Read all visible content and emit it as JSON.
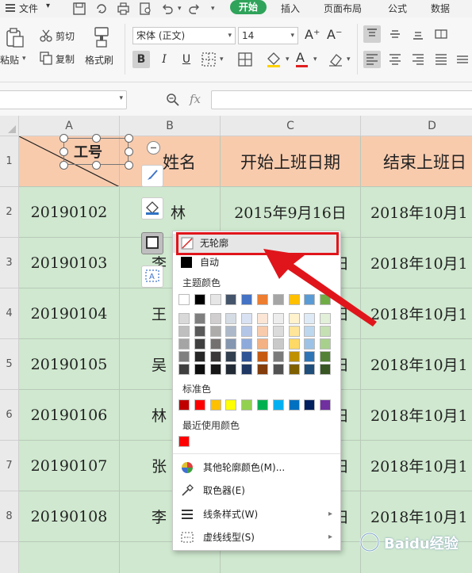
{
  "menubar": {
    "file_label": "文件",
    "tabs": [
      "开始",
      "插入",
      "页面布局",
      "公式",
      "数据"
    ]
  },
  "ribbon": {
    "paste_label": "粘贴",
    "cut_label": "剪切",
    "copy_label": "复制",
    "format_painter_label": "格式刷",
    "font_name": "宋体 (正文)",
    "font_size": "14",
    "bold": "B",
    "italic": "I",
    "underline": "U",
    "increase_font": "A⁺",
    "decrease_font": "A⁻",
    "font_color_accent": "#e02020"
  },
  "formula": {
    "fx_label": "fx"
  },
  "sheet": {
    "columns": [
      "A",
      "B",
      "C",
      "D"
    ],
    "rows": [
      "1",
      "2",
      "3",
      "4",
      "5",
      "6",
      "7",
      "8"
    ],
    "header": {
      "a": "工号",
      "b": "姓名",
      "c": "开始上班日期",
      "d": "结束上班日"
    },
    "data": [
      {
        "a": "20190102",
        "b": "林",
        "c": "2015年9月16日",
        "d": "2018年10月1"
      },
      {
        "a": "20190103",
        "b": "李",
        "c": "日",
        "d": "2018年10月1"
      },
      {
        "a": "20190104",
        "b": "王",
        "c": "日",
        "d": "2018年10月1"
      },
      {
        "a": "20190105",
        "b": "吴",
        "c": "日",
        "d": "2018年10月1"
      },
      {
        "a": "20190106",
        "b": "林",
        "c": "日",
        "d": "2018年10月1"
      },
      {
        "a": "20190107",
        "b": "张",
        "c": "日",
        "d": "2018年10月1"
      },
      {
        "a": "20190108",
        "b": "李",
        "c": "日",
        "d": "2018年10月1"
      }
    ]
  },
  "popup": {
    "no_outline": "无轮廓",
    "auto": "自动",
    "theme_colors_title": "主题颜色",
    "standard_colors_title": "标准色",
    "recent_colors_title": "最近使用颜色",
    "more_colors": "其他轮廓颜色(M)...",
    "eyedropper": "取色器(E)",
    "line_style": "线条样式(W)",
    "dash_style": "虚线线型(S)",
    "theme_row": [
      "#ffffff",
      "#000000",
      "#e7e6e6",
      "#44546a",
      "#4472c4",
      "#ed7d31",
      "#a5a5a5",
      "#ffc000",
      "#5b9bd5",
      "#70ad47"
    ],
    "theme_shades": [
      [
        "#d9d9d9",
        "#7f7f7f",
        "#d0cece",
        "#d6dce4",
        "#d9e2f3",
        "#fbe5d5",
        "#ededed",
        "#fff2cc",
        "#deebf6",
        "#e2efd9"
      ],
      [
        "#bfbfbf",
        "#595959",
        "#aeabab",
        "#adb9ca",
        "#b4c6e7",
        "#f7cbac",
        "#dbdbdb",
        "#fee599",
        "#bdd7ee",
        "#c5e0b3"
      ],
      [
        "#a5a5a5",
        "#3f3f3f",
        "#757070",
        "#8496b0",
        "#8eaadb",
        "#f4b183",
        "#c9c9c9",
        "#ffd965",
        "#9cc3e5",
        "#a8d08d"
      ],
      [
        "#7f7f7f",
        "#262626",
        "#3a3838",
        "#323f4f",
        "#2f5496",
        "#c55a11",
        "#7b7b7b",
        "#bf9000",
        "#2e75b5",
        "#538135"
      ],
      [
        "#3f3f3f",
        "#0d0d0d",
        "#171616",
        "#222a35",
        "#1f3864",
        "#833c0b",
        "#525252",
        "#7f6000",
        "#1e4e79",
        "#375623"
      ]
    ],
    "standard_row": [
      "#c00000",
      "#ff0000",
      "#ffc000",
      "#ffff00",
      "#92d050",
      "#00b050",
      "#00b0f0",
      "#0070c0",
      "#002060",
      "#7030a0"
    ],
    "recent_row": [
      "#ff0000"
    ]
  },
  "highlight_color": "#e0151b",
  "watermark": "Baidu经验"
}
